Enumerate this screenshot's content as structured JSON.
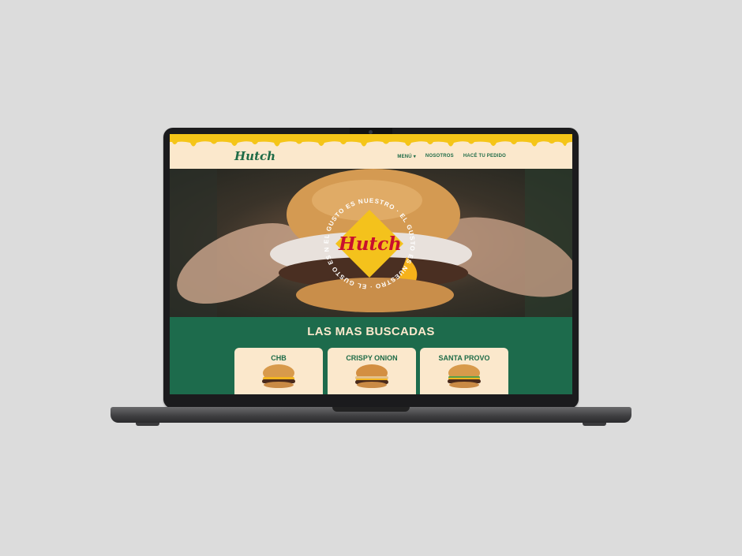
{
  "site": {
    "logo_text": "Hutch",
    "nav": [
      {
        "label": "MENÚ ▾"
      },
      {
        "label": "NOSOTROS"
      },
      {
        "label": "HACÉ TU PEDIDO"
      }
    ]
  },
  "hero": {
    "badge_logo": "Hutch",
    "badge_ring_text": "EL GUSTO ES NUESTRO · EL GUSTO ES NUESTRO · EL GUSTO ES NUESTRO ·"
  },
  "section": {
    "title": "LAS MAS BUSCADAS",
    "cards": [
      {
        "title": "CHB"
      },
      {
        "title": "CRISPY ONION"
      },
      {
        "title": "SANTA PROVO"
      }
    ]
  },
  "colors": {
    "brand_green": "#1d6b4c",
    "cream": "#fbe8cc",
    "drip_yellow": "#f5c518",
    "logo_red": "#c8102e"
  },
  "icons": [
    "burger-image",
    "hero-burger-photo",
    "badge-diamond"
  ]
}
